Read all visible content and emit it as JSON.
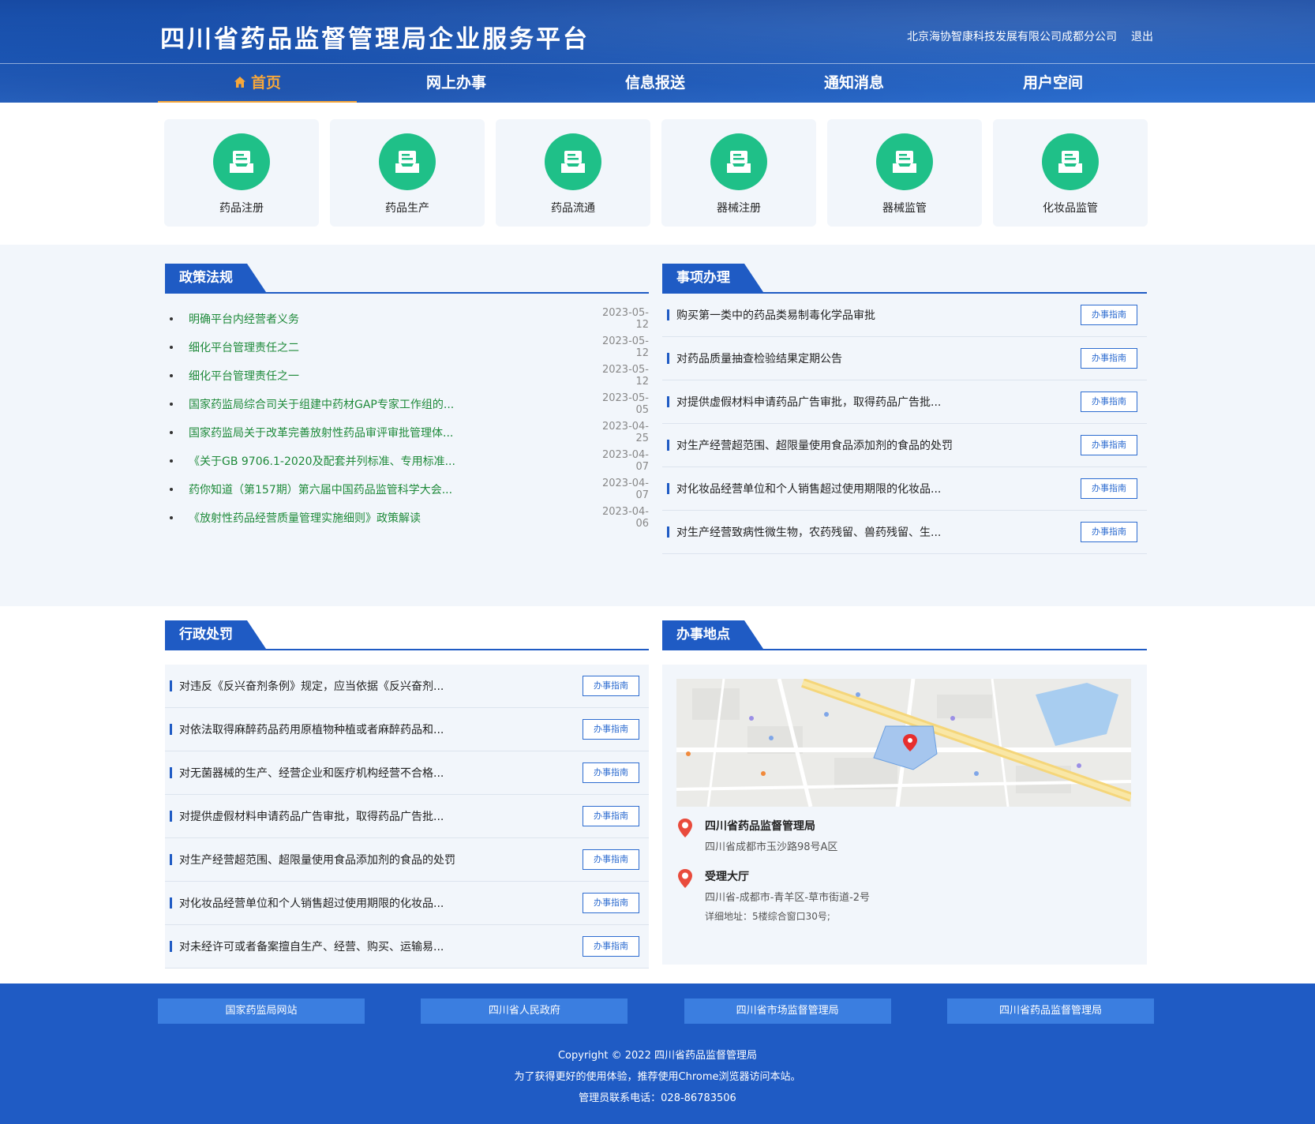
{
  "header": {
    "title": "四川省药品监督管理局企业服务平台",
    "company": "北京海协智康科技发展有限公司成都分公司",
    "logout": "退出"
  },
  "nav": [
    {
      "label": "首页",
      "active": true
    },
    {
      "label": "网上办事"
    },
    {
      "label": "信息报送"
    },
    {
      "label": "通知消息"
    },
    {
      "label": "用户空间"
    }
  ],
  "services": [
    {
      "label": "药品注册",
      "icon": "inbox-icon"
    },
    {
      "label": "药品生产",
      "icon": "inbox-icon"
    },
    {
      "label": "药品流通",
      "icon": "inbox-icon"
    },
    {
      "label": "器械注册",
      "icon": "inbox-icon"
    },
    {
      "label": "器械监管",
      "icon": "inbox-icon"
    },
    {
      "label": "化妆品监管",
      "icon": "inbox-icon"
    }
  ],
  "policy": {
    "title": "政策法规",
    "items": [
      {
        "title": "明确平台内经营者义务",
        "date": "2023-05-12"
      },
      {
        "title": "细化平台管理责任之二",
        "date": "2023-05-12"
      },
      {
        "title": "细化平台管理责任之一",
        "date": "2023-05-12"
      },
      {
        "title": "国家药监局综合司关于组建中药材GAP专家工作组的...",
        "date": "2023-05-05"
      },
      {
        "title": "国家药监局关于改革完善放射性药品审评审批管理体...",
        "date": "2023-04-25"
      },
      {
        "title": "《关于GB 9706.1-2020及配套并列标准、专用标准...",
        "date": "2023-04-07"
      },
      {
        "title": "药你知道（第157期）第六届中国药品监管科学大会...",
        "date": "2023-04-07"
      },
      {
        "title": "《放射性药品经营质量管理实施细则》政策解读",
        "date": "2023-04-06"
      }
    ]
  },
  "matters": {
    "title": "事项办理",
    "button": "办事指南",
    "items": [
      "购买第一类中的药品类易制毒化学品审批",
      "对药品质量抽查检验结果定期公告",
      "对提供虚假材料申请药品广告审批，取得药品广告批...",
      "对生产经营超范围、超限量使用食品添加剂的食品的处罚",
      "对化妆品经营单位和个人销售超过使用期限的化妆品...",
      "对生产经营致病性微生物，农药残留、兽药残留、生..."
    ]
  },
  "penalty": {
    "title": "行政处罚",
    "button": "办事指南",
    "items": [
      "对违反《反兴奋剂条例》规定，应当依据《反兴奋剂...",
      "对依法取得麻醉药品药用原植物种植或者麻醉药品和...",
      "对无菌器械的生产、经营企业和医疗机构经营不合格...",
      "对提供虚假材料申请药品广告审批，取得药品广告批...",
      "对生产经营超范围、超限量使用食品添加剂的食品的处罚",
      "对化妆品经营单位和个人销售超过使用期限的化妆品...",
      "对未经许可或者备案擅自生产、经营、购买、运输易..."
    ]
  },
  "locations": {
    "title": "办事地点",
    "places": [
      {
        "name": "四川省药品监督管理局",
        "address": "四川省成都市玉沙路98号A区"
      },
      {
        "name": "受理大厅",
        "address": "四川省-成都市-青羊区-草市街道-2号",
        "detail": "详细地址：5楼综合窗口30号;"
      }
    ]
  },
  "footer": {
    "links": [
      "国家药监局网站",
      "四川省人民政府",
      "四川省市场监督管理局",
      "四川省药品监督管理局"
    ],
    "copyright": "Copyright © 2022 四川省药品监督管理局",
    "tip": "为了获得更好的使用体验，推荐使用Chrome浏览器访问本站。",
    "phone": "管理员联系电话：028-86783506"
  },
  "colors": {
    "primary": "#1f5bc4",
    "accent": "#f7a73a",
    "service": "#1fc088",
    "link": "#1e8a3a"
  }
}
